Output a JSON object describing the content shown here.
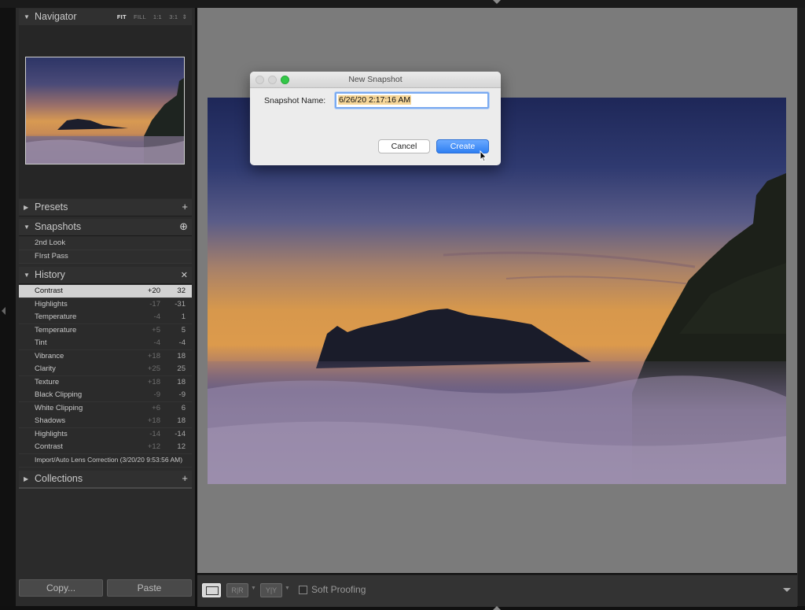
{
  "navigator": {
    "title": "Navigator",
    "modes": [
      "FIT",
      "FILL",
      "1:1",
      "3:1"
    ],
    "active_mode": "FIT",
    "mode_arrow": "⇕"
  },
  "presets": {
    "title": "Presets",
    "action": "+"
  },
  "snapshots": {
    "title": "Snapshots",
    "action": "⊕",
    "items": [
      "2nd Look",
      "FIrst Pass"
    ]
  },
  "history": {
    "title": "History",
    "action": "✕",
    "items": [
      {
        "label": "Contrast",
        "change": "+20",
        "value": "32",
        "selected": true
      },
      {
        "label": "Highlights",
        "change": "-17",
        "value": "-31"
      },
      {
        "label": "Temperature",
        "change": "-4",
        "value": "1"
      },
      {
        "label": "Temperature",
        "change": "+5",
        "value": "5"
      },
      {
        "label": "Tint",
        "change": "-4",
        "value": "-4"
      },
      {
        "label": "Vibrance",
        "change": "+18",
        "value": "18"
      },
      {
        "label": "Clarity",
        "change": "+25",
        "value": "25"
      },
      {
        "label": "Texture",
        "change": "+18",
        "value": "18"
      },
      {
        "label": "Black Clipping",
        "change": "-9",
        "value": "-9"
      },
      {
        "label": "White Clipping",
        "change": "+6",
        "value": "6"
      },
      {
        "label": "Shadows",
        "change": "+18",
        "value": "18"
      },
      {
        "label": "Highlights",
        "change": "-14",
        "value": "-14"
      },
      {
        "label": "Contrast",
        "change": "+12",
        "value": "12"
      },
      {
        "label": "Import/Auto Lens Correction (3/20/20 9:53:56 AM)",
        "change": "",
        "value": ""
      }
    ]
  },
  "collections": {
    "title": "Collections",
    "action": "+"
  },
  "bottom_buttons": {
    "copy": "Copy...",
    "paste": "Paste"
  },
  "toolbar": {
    "loupe_icon": "loupe-view-icon",
    "before_after_lr": "R|R",
    "before_after_ud": "Y|Y",
    "soft_proofing_label": "Soft Proofing",
    "soft_proofing_checked": false
  },
  "dialog": {
    "title": "New Snapshot",
    "name_label": "Snapshot Name:",
    "name_value": "6/26/20 2:17:16 AM",
    "cancel_label": "Cancel",
    "create_label": "Create"
  },
  "colors": {
    "accent_blue": "#2f7ff2",
    "panel_bg": "#2b2b2b",
    "canvas_bg": "#7b7b7b",
    "selected_row": "#d2d2d2"
  }
}
